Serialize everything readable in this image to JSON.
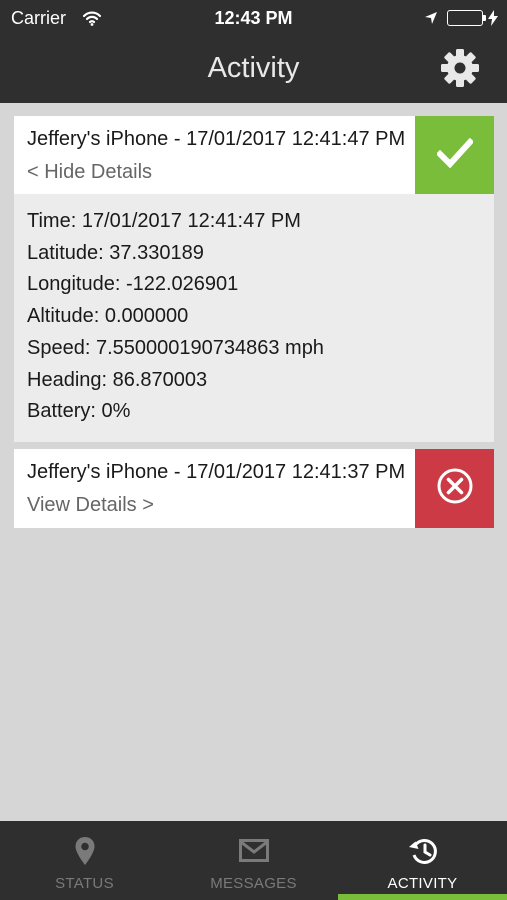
{
  "status_bar": {
    "carrier": "Carrier",
    "time": "12:43 PM"
  },
  "nav": {
    "title": "Activity"
  },
  "entries": [
    {
      "title": "Jeffery's iPhone - 17/01/2017 12:41:47 PM",
      "toggle": "< Hide Details",
      "status": "success",
      "details": [
        "Time: 17/01/2017 12:41:47 PM",
        "Latitude: 37.330189",
        "Longitude: -122.026901",
        "Altitude: 0.000000",
        "Speed: 7.550000190734863 mph",
        "Heading: 86.870003",
        "Battery: 0%"
      ]
    },
    {
      "title": "Jeffery's iPhone - 17/01/2017 12:41:37 PM",
      "toggle": "View Details >",
      "status": "failed"
    }
  ],
  "tabs": [
    {
      "label": "STATUS",
      "icon": "map-pin-icon"
    },
    {
      "label": "MESSAGES",
      "icon": "envelope-icon"
    },
    {
      "label": "ACTIVITY",
      "icon": "history-icon",
      "active": true
    }
  ],
  "colors": {
    "header": "#2f2f2f",
    "success": "#79bd3a",
    "failure": "#cc3b45",
    "background": "#d6d6d6"
  }
}
